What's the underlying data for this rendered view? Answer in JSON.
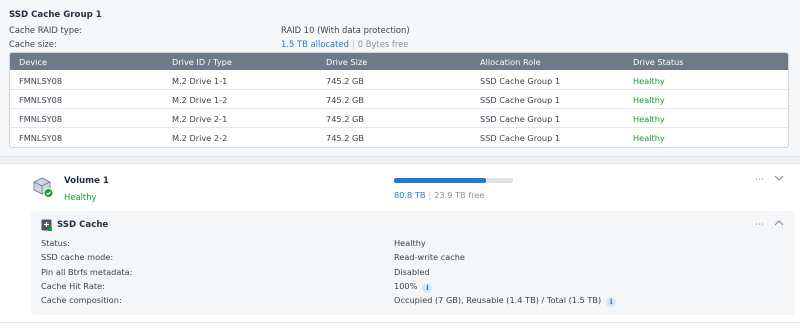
{
  "ssd_group": {
    "title": "SSD Cache Group 1",
    "raid_type_label": "Cache RAID type:",
    "raid_type_value": "RAID 10 (With data protection)",
    "cache_size_label": "Cache size:",
    "cache_allocated": "1.5 TB allocated",
    "cache_free": "0 Bytes free"
  },
  "table": {
    "headers": [
      "Device",
      "Drive ID / Type",
      "Drive Size",
      "Allocation Role",
      "Drive Status"
    ],
    "rows": [
      {
        "device": "FMNLSY08",
        "drive_id": "M.2 Drive 1-1",
        "size": "745.2 GB",
        "role": "SSD Cache Group 1",
        "status": "Healthy"
      },
      {
        "device": "FMNLSY08",
        "drive_id": "M.2 Drive 1-2",
        "size": "745.2 GB",
        "role": "SSD Cache Group 1",
        "status": "Healthy"
      },
      {
        "device": "FMNLSY08",
        "drive_id": "M.2 Drive 2-1",
        "size": "745.2 GB",
        "role": "SSD Cache Group 1",
        "status": "Healthy"
      },
      {
        "device": "FMNLSY08",
        "drive_id": "M.2 Drive 2-2",
        "size": "745.2 GB",
        "role": "SSD Cache Group 1",
        "status": "Healthy"
      }
    ]
  },
  "volume": {
    "title": "Volume 1",
    "status": "Healthy",
    "used": "80.8 TB",
    "free": "23.9 TB free",
    "usage_fraction": 0.77,
    "icons": {
      "more": "ellipsis-icon",
      "toggle": "chevron-down-icon"
    }
  },
  "ssd_cache": {
    "title": "SSD Cache",
    "icons": {
      "more": "ellipsis-icon",
      "toggle": "chevron-up-icon"
    },
    "rows": [
      {
        "label": "Status:",
        "value": "Healthy"
      },
      {
        "label": "SSD cache mode:",
        "value": "Read-write cache"
      },
      {
        "label": "Pin all Btrfs metadata:",
        "value": "Disabled"
      },
      {
        "label": "Cache Hit Rate:",
        "value": "100%"
      },
      {
        "label": "Cache composition:",
        "value": "Occupied (7 GB), Reusable (1.4 TB) / Total (1.5 TB)"
      }
    ]
  },
  "colors": {
    "accent": "#1f7ad3",
    "healthy": "#1a9a3a",
    "table_header": "#6e7a87"
  }
}
